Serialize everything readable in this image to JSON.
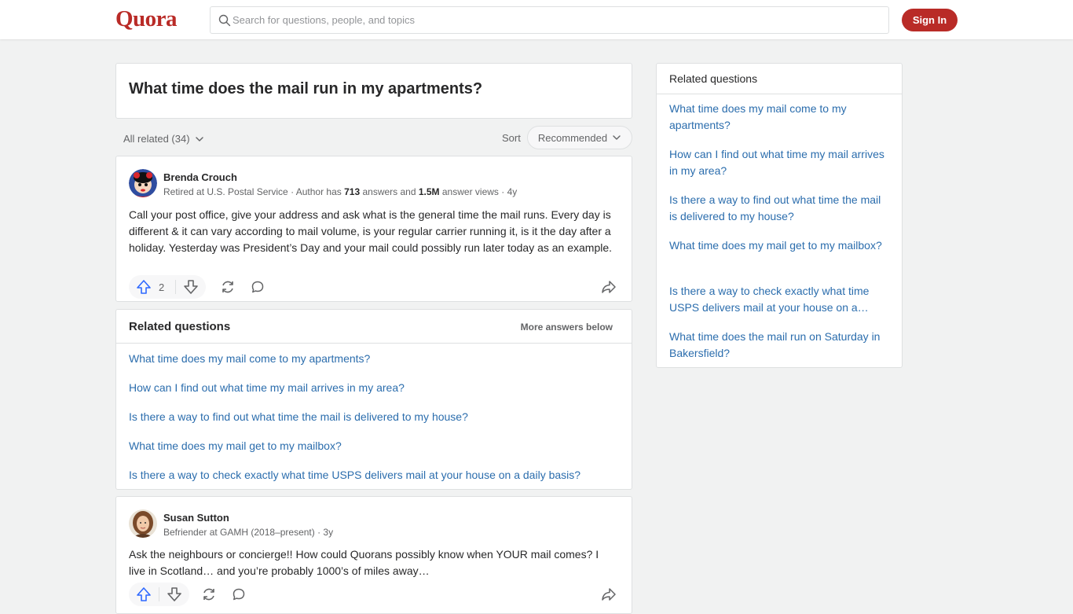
{
  "header": {
    "logo": "Quora",
    "search_placeholder": "Search for questions, people, and topics",
    "sign_in": "Sign In"
  },
  "question": {
    "title": "What time does the mail run in my apartments?"
  },
  "filters": {
    "all_related": "All related (34)",
    "sort_label": "Sort",
    "sort_value": "Recommended"
  },
  "answers": [
    {
      "author": "Brenda Crouch",
      "cred_prefix": "Retired at U.S. Postal Service · Author has ",
      "answers_count": "713",
      "cred_mid": " answers and ",
      "views": "1.5M",
      "cred_suffix": " answer views · 4y",
      "text": "Call your post office, give your address and ask what is the general time the mail runs. Every day is different & it can vary according to mail volume, is your regular carrier running it, is it the day after a holiday. Yesterday was President’s Day and your mail could possibly run later today as an example.",
      "upvotes": "2"
    },
    {
      "author": "Susan Sutton",
      "cred": "Befriender at GAMH (2018–present) · 3y",
      "text": "Ask the neighbours or concierge!! How could Quorans possibly know when YOUR mail comes? I live in Scotland… and you’re probably 1000’s of miles away…"
    }
  ],
  "related_inline": {
    "title": "Related questions",
    "more": "More answers below",
    "items": [
      "What time does my mail come to my apartments?",
      "How can I find out what time my mail arrives in my area?",
      "Is there a way to find out what time the mail is delivered to my house?",
      "What time does my mail get to my mailbox?",
      "Is there a way to check exactly what time USPS delivers mail at your house on a daily basis?"
    ]
  },
  "sidebar": {
    "title": "Related questions",
    "items": [
      "What time does my mail come to my apartments?",
      "How can I find out what time my mail arrives in my area?",
      "Is there a way to find out what time the mail is delivered to my house?",
      "What time does my mail get to my mailbox?",
      "Is there a way to check exactly what time USPS delivers mail at your house on a…",
      "What time does the mail run on Saturday in Bakersfield?"
    ]
  },
  "colors": {
    "brand": "#b92b27",
    "link": "#2b6dad",
    "upvote": "#2e69ff"
  }
}
